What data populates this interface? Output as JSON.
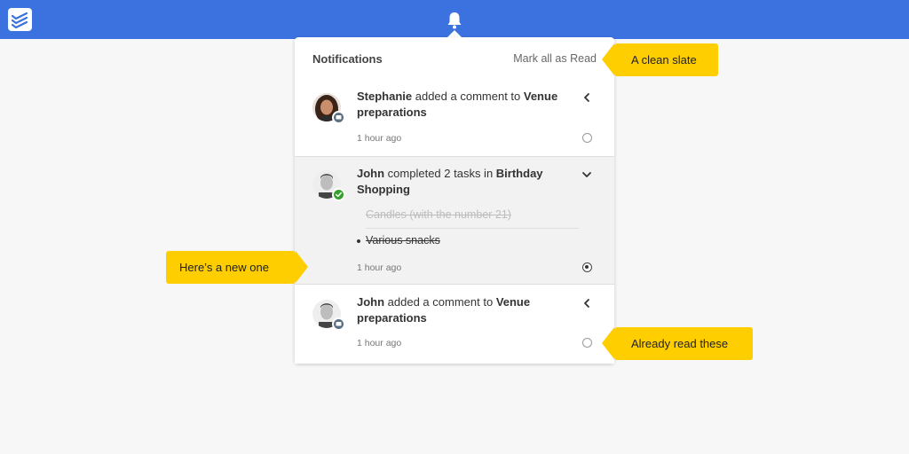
{
  "app": {
    "logo_icon": "stacked-checks-icon",
    "bell_icon": "bell-icon",
    "brand_color": "#3b72e0"
  },
  "panel": {
    "title": "Notifications",
    "mark_all_label": "Mark all as Read"
  },
  "notifications": [
    {
      "actor": "Stephanie",
      "action": " added a comment to ",
      "target": "Venue preparations",
      "time": "1 hour ago",
      "badge_icon": "comment-icon",
      "toggle_icon": "chevron-left-icon",
      "status": "read"
    },
    {
      "actor": "John",
      "action": " completed 2 tasks in ",
      "target": "Birthday Shopping",
      "time": "1 hour ago",
      "badge_icon": "check-icon",
      "toggle_icon": "chevron-down-icon",
      "status": "unread",
      "tasks": [
        "Candles (with the number 21)",
        "Various snacks"
      ]
    },
    {
      "actor": "John",
      "action": " added a comment to ",
      "target": "Venue preparations",
      "time": "1 hour ago",
      "badge_icon": "comment-icon",
      "toggle_icon": "chevron-left-icon",
      "status": "read"
    }
  ],
  "callouts": {
    "clean_slate": "A clean slate",
    "new_one": "Here’s a new one",
    "already_read": "Already read these"
  },
  "callout_color": "#ffce00"
}
